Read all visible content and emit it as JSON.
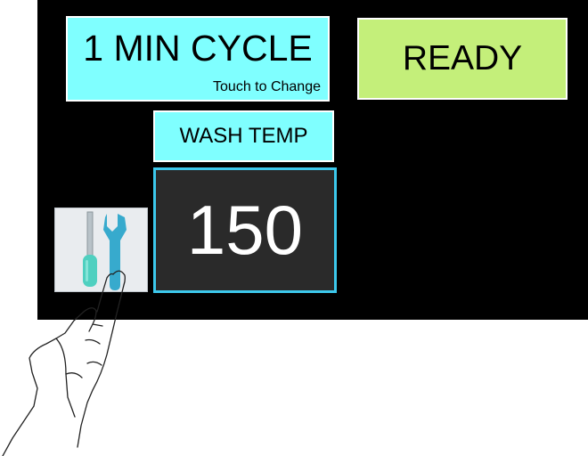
{
  "cycle": {
    "title": "1 MIN CYCLE",
    "hint": "Touch to Change"
  },
  "status": {
    "label": "READY"
  },
  "wash_temp": {
    "label": "WASH TEMP",
    "value": "150"
  },
  "icons": {
    "settings": "tools-icon",
    "pointer": "hand-pointer-icon"
  },
  "colors": {
    "screen": "#000000",
    "cyan_button": "#7fffff",
    "ready_button": "#c4ef7a",
    "value_border": "#3cc8ec",
    "value_bg": "#2a2a2a",
    "tools_bg": "#e9ecef"
  }
}
